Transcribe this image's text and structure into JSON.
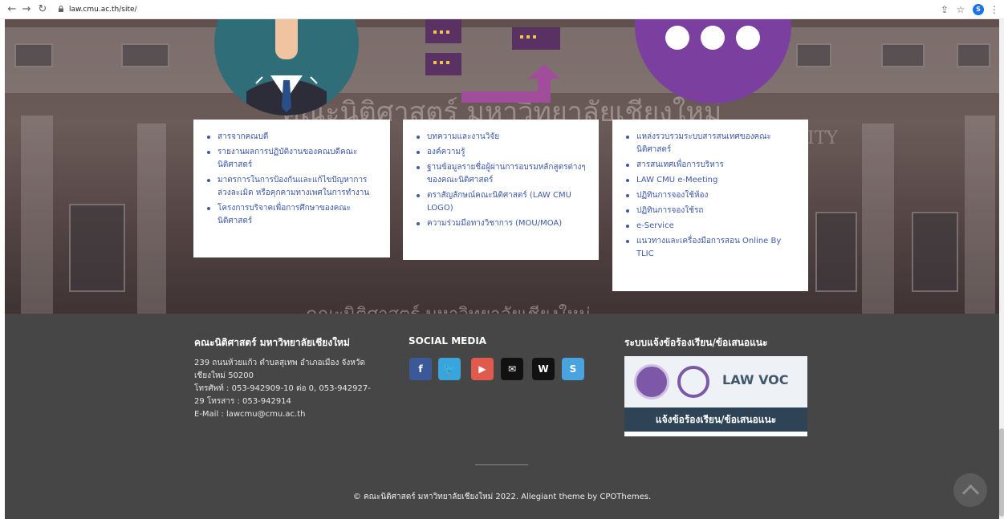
{
  "browser": {
    "url": "law.cmu.ac.th/site/",
    "profile_initial": "S"
  },
  "hero": {
    "sign_th": "คณะนิติศาสตร์ มหาวิทยาลัยเชียงใหม่",
    "sign_en": "ITY",
    "sign_bottom": "คณะนิติศาสตร์ มหาวิทยาลัยเชียงใหม่"
  },
  "cards": [
    {
      "items": [
        "สารจากคณบดี",
        "รายงานผลการปฏิบัติงานของคณบดีคณะนิติศาสตร์",
        "มาตรการในการป้องกันและแก้ไขปัญหาการล่วงละเมิด หรือคุกคามทางเพศในการทำงาน",
        "โครงการบริจาคเพื่อการศึกษาของคณะนิติศาสตร์"
      ]
    },
    {
      "items": [
        "บทความและงานวิจัย",
        "องค์ความรู้",
        "ฐานข้อมูลรายชื่อผู้ผ่านการอบรมหลักสูตรต่างๆของคณะนิติศาสตร์",
        "ตราสัญลักษณ์คณะนิติศาสตร์ (LAW CMU LOGO)",
        "ความร่วมมือทางวิชาการ (MOU/MOA)"
      ]
    },
    {
      "items": [
        "แหล่งรวบรวมระบบสารสนเทศของคณะนิติศาสตร์",
        "สารสนเทศเพื่อการบริหาร",
        "LAW CMU e-Meeting",
        "ปฏิทินการจองใช้ห้อง",
        "ปฏิทินการจองใช้รถ",
        "e-Service",
        "แนวทางและเครื่องมือการสอน Online By TLIC"
      ]
    }
  ],
  "footer": {
    "about_heading": "คณะนิติศาสตร์ มหาวิทยาลัยเชียงใหม่",
    "address_line1": "239 ถนนห้วยแก้ว ตำบลสุเทพ อำเภอเมือง จังหวัด",
    "address_line2": "เชียงใหม่ 50200",
    "phone_line1": "โทรศัพท์ : 053-942909-10 ต่อ 0, 053-942927-",
    "phone_line2": "29 โทรสาร : 053-942914",
    "email": "E-Mail : lawcmu@cmu.ac.th",
    "social_heading": "SOCIAL MEDIA",
    "social_icons": [
      {
        "icon": "facebook-icon",
        "glyph": "f",
        "color": "#3b5998"
      },
      {
        "icon": "twitter-icon",
        "glyph": "🐦",
        "color": "#3aa5dc"
      },
      {
        "icon": "youtube-icon",
        "glyph": "▶",
        "color": "#e05a4e"
      },
      {
        "icon": "email-icon",
        "glyph": "✉",
        "color": "#111111"
      },
      {
        "icon": "wordpress-icon",
        "glyph": "W",
        "color": "#111111"
      },
      {
        "icon": "skype-icon",
        "glyph": "S",
        "color": "#4aa3df"
      }
    ],
    "complaint_heading": "ระบบแจ้งข้อร้องเรียน/ข้อเสนอแนะ",
    "voc_title": "LAW VOC",
    "voc_caption": "แจ้งข้อร้องเรียน/ข้อเสนอแนะ",
    "copyright": "© คณะนิติศาสตร์ มหาวิทยาลัยเชียงใหม่ 2022. Allegiant theme by CPOThemes."
  }
}
